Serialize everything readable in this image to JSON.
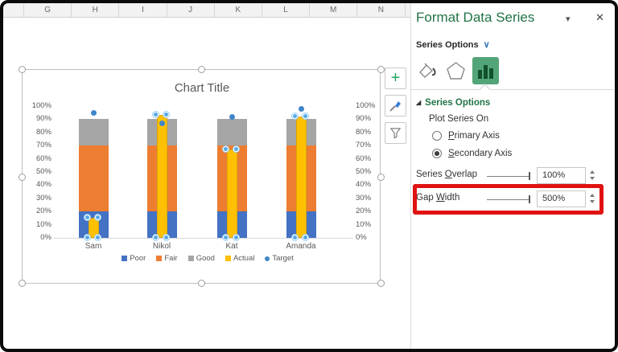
{
  "sheet": {
    "column_headers": [
      "G",
      "H",
      "I",
      "J",
      "K",
      "L",
      "M",
      "N"
    ]
  },
  "chart_data": {
    "type": "bar",
    "title": "Chart Title",
    "categories": [
      "Sam",
      "Nikol",
      "Kat",
      "Amanda"
    ],
    "series": [
      {
        "name": "Poor",
        "render": "stacked",
        "values": [
          20,
          20,
          20,
          20
        ],
        "color": "#4472C4"
      },
      {
        "name": "Fair",
        "render": "stacked",
        "values": [
          50,
          50,
          50,
          50
        ],
        "color": "#ED7D31"
      },
      {
        "name": "Good",
        "render": "stacked",
        "values": [
          20,
          20,
          20,
          20
        ],
        "color": "#A5A5A5"
      },
      {
        "name": "Actual",
        "render": "overlay-column",
        "values": [
          15,
          93,
          67,
          92
        ],
        "color": "#FFC000",
        "selected": true
      },
      {
        "name": "Target",
        "render": "scatter",
        "values": [
          95,
          87,
          92,
          98
        ],
        "color": "#3f86c9"
      }
    ],
    "y_axis": {
      "min": 0,
      "max": 100,
      "step": 10,
      "ticks": [
        "100%",
        "90%",
        "80%",
        "70%",
        "60%",
        "50%",
        "40%",
        "30%",
        "20%",
        "10%",
        "0%"
      ]
    },
    "secondary_axis_shown": true,
    "legend_position": "bottom",
    "gridlines": false
  },
  "chart_tools": {
    "add_label": "+",
    "buttons": [
      "chart-elements",
      "chart-styles",
      "chart-filters"
    ]
  },
  "panel": {
    "title": "Format Data Series",
    "collapse_icon": "▾",
    "close_icon": "✕",
    "section_label": "Series Options",
    "section_chevron": "∨",
    "expand_icon": "◢",
    "options_header": "Series Options",
    "plot_series_on": "Plot Series On",
    "radio_primary": {
      "pre": "",
      "u": "P",
      "post": "rimary Axis",
      "selected": false
    },
    "radio_secondary": {
      "pre": "",
      "u": "S",
      "post": "econdary Axis",
      "selected": true
    },
    "series_overlap": {
      "pre": "Series ",
      "u": "O",
      "post": "verlap",
      "value": "100%"
    },
    "gap_width": {
      "pre": "Gap ",
      "u": "W",
      "post": "idth",
      "value": "500%"
    }
  },
  "colors": {
    "pane_title_green": "#217346",
    "selected_tab_green": "#52a578",
    "highlight_red": "#e01212",
    "axis_text": "#595959"
  }
}
